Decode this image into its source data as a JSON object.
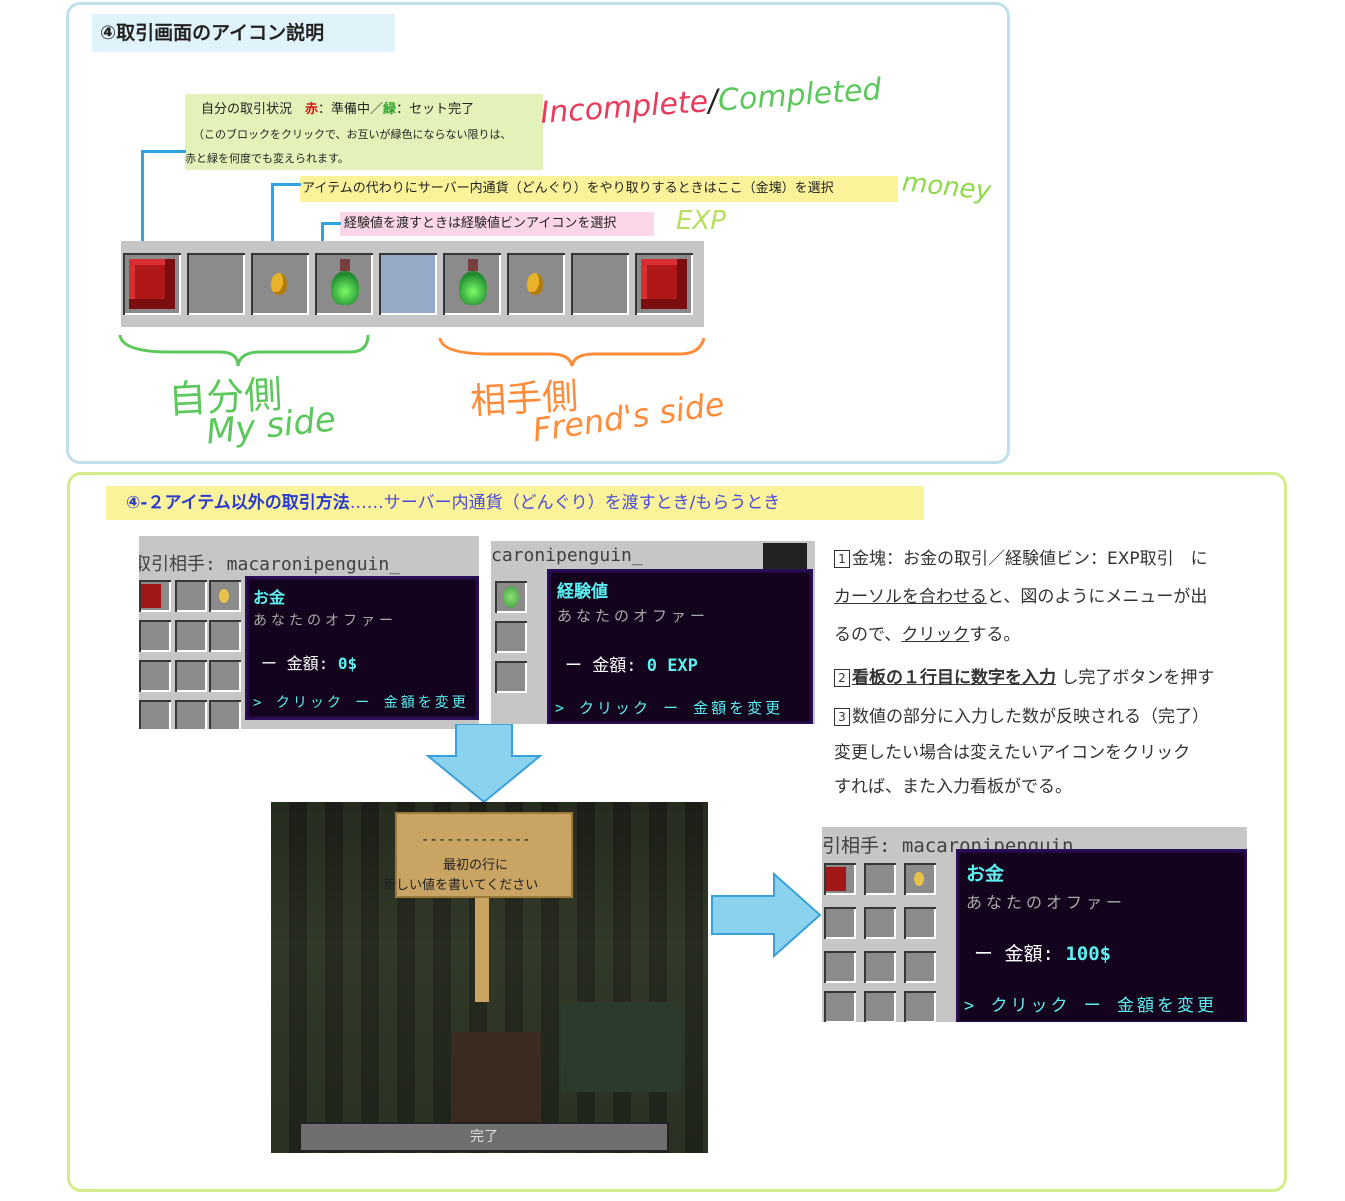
{
  "section1": {
    "title": "④取引画面のアイコン説明",
    "note_status": {
      "prefix": "自分の取引状況　",
      "red_word": "赤",
      "mid": "：準備中／",
      "green_word": "緑",
      "suffix": "：セット完了",
      "line2": "（このブロックをクリックで、お互いが緑色にならない限りは、",
      "line3": "赤と緑を何度でも変えられます。"
    },
    "note_money": "アイテムの代わりにサーバー内通貨（どんぐり）をやり取りするときはここ（金塊）を選択",
    "note_exp": "経験値を渡すときは経験値ビンアイコンを選択",
    "hand_incomplete": "Incomplete",
    "hand_slash": "/",
    "hand_completed": "Completed",
    "hand_money": "money",
    "hand_exp": "EXP",
    "hand_my_jp": "自分側",
    "hand_my_en": "My side",
    "hand_friend_jp": "相手側",
    "hand_friend_en": "Frend's side"
  },
  "section2": {
    "title_bold": "④-２アイテム以外の取引方法",
    "title_rest": "……サーバー内通貨（どんぐり）を渡すとき/もらうとき",
    "shot1": {
      "header": "取引相手: macaronipenguin_",
      "tip_title": "お金",
      "tip_sub": "あなたのオファー",
      "tip_amount_label": "ー 金額: ",
      "tip_amount_value": "0$",
      "tip_click": "> クリック ー 金額を変更"
    },
    "shot2": {
      "header": "caronipenguin_",
      "tip_title": "経験値",
      "tip_sub": "あなたのオファー",
      "tip_amount_label": "ー 金額: ",
      "tip_amount_value": "0 EXP",
      "tip_click": "> クリック ー 金額を変更"
    },
    "sign": {
      "line1": "-------------",
      "line2": "最初の行に",
      "line3": "新しい値を書いてください",
      "done": "完了"
    },
    "shot3": {
      "header": "引相手: macaronipenguin",
      "tip_title": "お金",
      "tip_sub": "あなたのオファー",
      "tip_amount_label": "ー 金額: ",
      "tip_amount_value": "100$",
      "tip_click": "> クリック ー 金額を変更"
    },
    "instructions": {
      "s1_num": "1",
      "s1_a": "金塊：お金の取引／経験値ビン：EXP取引　に",
      "s1_b_u": "カーソルを合わせる",
      "s1_b_rest": "と、図のようにメニューが出",
      "s1_c_a": "るので、",
      "s1_c_u": "クリック",
      "s1_c_b": "する。",
      "s2_num": "2",
      "s2_bold": "看板の１行目に数字を入力",
      "s2_rest": "し完了ボタンを押す",
      "s3_num": "3",
      "s3_text": "数値の部分に入力した数が反映される（完了）",
      "s4_a": "変更したい場合は変えたいアイコンをクリック",
      "s4_b": "すれば、また入力看板がでる。"
    }
  },
  "colors": {
    "box1_border": "#bfe0ea",
    "box2_border": "#d4ec8a",
    "handwriting_red": "#e83a5a",
    "handwriting_green": "#5cc85c",
    "handwriting_orange": "#ff8c3a",
    "tooltip_cyan": "#5cf0f0",
    "arrow_blue": "#2fa2e0"
  }
}
